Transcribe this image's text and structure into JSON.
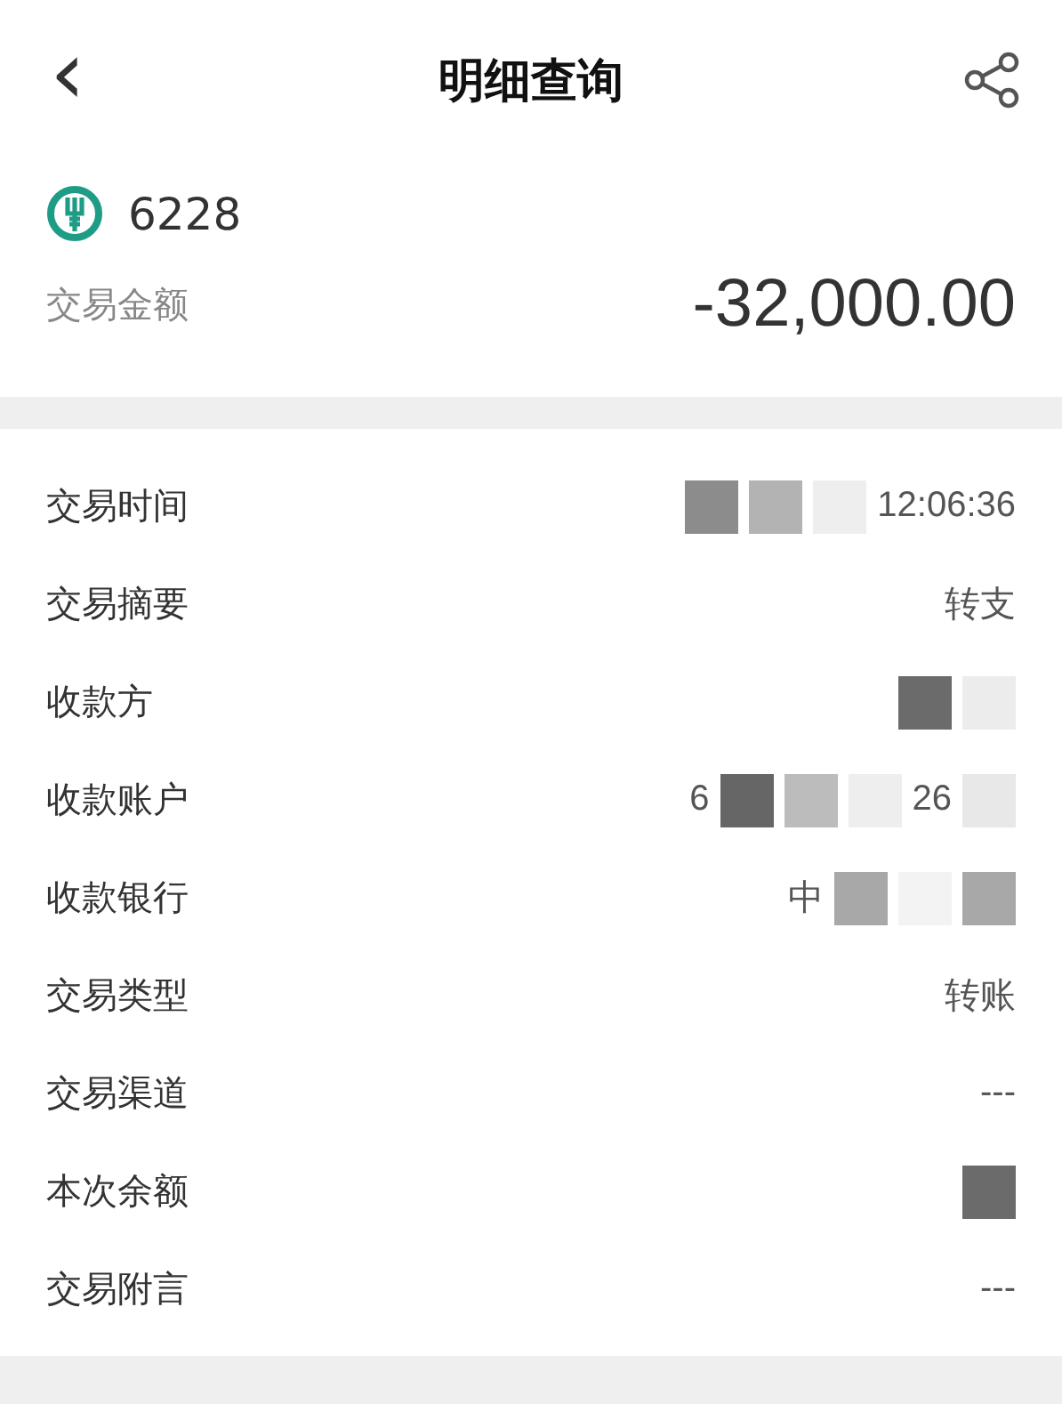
{
  "header": {
    "back": "‹",
    "title": "明细查询"
  },
  "account": {
    "number": "6228",
    "amount_label": "交易金额",
    "amount": "-32,000.00"
  },
  "rows": [
    {
      "label": "交易时间",
      "value": [
        {
          "kind": "mask",
          "color": "#8c8c8c"
        },
        {
          "kind": "mask",
          "color": "#b3b3b3"
        },
        {
          "kind": "mask",
          "color": "#eeeeee"
        },
        {
          "kind": "text",
          "text": "12:06:36"
        }
      ]
    },
    {
      "label": "交易摘要",
      "value": [
        {
          "kind": "text",
          "text": "转支"
        }
      ]
    },
    {
      "label": "收款方",
      "value": [
        {
          "kind": "mask",
          "color": "#6b6b6b"
        },
        {
          "kind": "mask",
          "color": "#ececec"
        }
      ]
    },
    {
      "label": "收款账户",
      "value": [
        {
          "kind": "text",
          "text": "6"
        },
        {
          "kind": "mask",
          "color": "#666666"
        },
        {
          "kind": "mask",
          "color": "#bcbcbc"
        },
        {
          "kind": "mask",
          "color": "#eeeeee"
        },
        {
          "kind": "text",
          "text": "26"
        },
        {
          "kind": "mask",
          "color": "#e8e8e8"
        }
      ]
    },
    {
      "label": "收款银行",
      "value": [
        {
          "kind": "text",
          "text": "中"
        },
        {
          "kind": "mask",
          "color": "#a8a8a8"
        },
        {
          "kind": "mask",
          "color": "#f3f3f3"
        },
        {
          "kind": "mask",
          "color": "#a8a8a8"
        }
      ]
    },
    {
      "label": "交易类型",
      "value": [
        {
          "kind": "text",
          "text": "转账"
        }
      ]
    },
    {
      "label": "交易渠道",
      "value": [
        {
          "kind": "text",
          "text": "---"
        }
      ]
    },
    {
      "label": "本次余额",
      "value": [
        {
          "kind": "mask",
          "color": "#6b6b6b"
        }
      ]
    },
    {
      "label": "交易附言",
      "value": [
        {
          "kind": "text",
          "text": "---"
        }
      ]
    }
  ]
}
